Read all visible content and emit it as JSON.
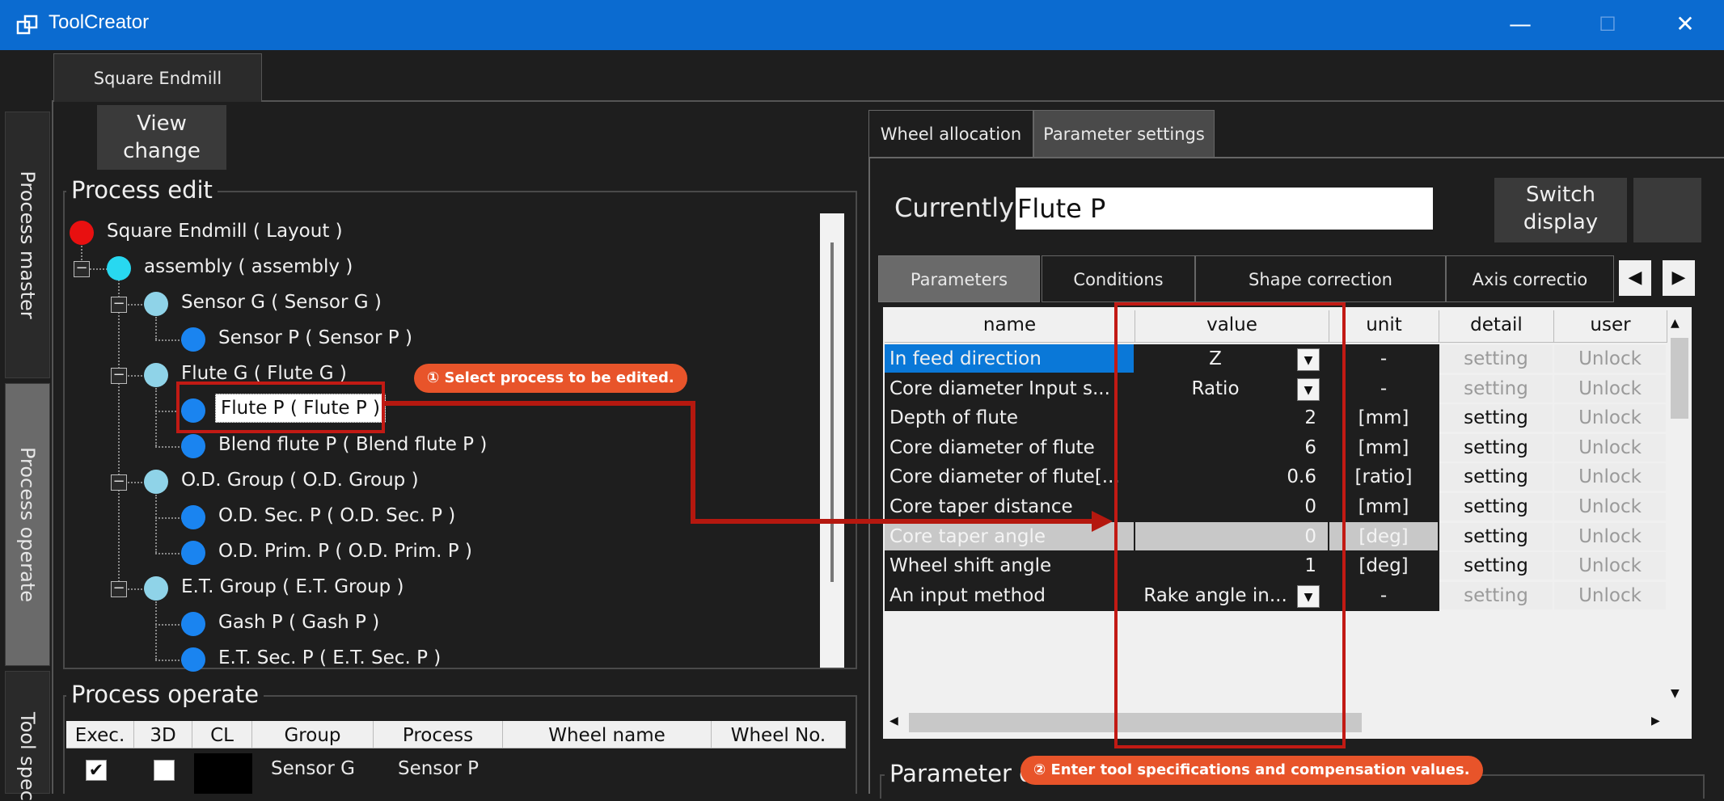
{
  "window": {
    "title": "ToolCreator",
    "minimize_glyph": "—",
    "maximize_glyph": "☐",
    "close_glyph": "✕"
  },
  "side_tabs": [
    "Process master",
    "Process operate",
    "Tool spec"
  ],
  "top_tab": "Square Endmill",
  "view_change_label": "View\nchange",
  "process_edit": {
    "title": "Process edit",
    "tree": [
      {
        "label": "Square Endmill ( Layout )",
        "color": "#e81010"
      },
      {
        "label": "assembly ( assembly )",
        "color": "#28d8f0"
      },
      {
        "label": "Sensor G ( Sensor G )",
        "color": "#8fd3e8"
      },
      {
        "label": "Sensor P ( Sensor P )",
        "color": "#1a84f0"
      },
      {
        "label": "Flute G ( Flute G )",
        "color": "#8fd3e8"
      },
      {
        "label": "Flute P ( Flute P )",
        "color": "#1a84f0"
      },
      {
        "label": "Blend flute P ( Blend flute P )",
        "color": "#1a84f0"
      },
      {
        "label": "O.D. Group ( O.D. Group )",
        "color": "#8fd3e8"
      },
      {
        "label": "O.D. Sec. P ( O.D. Sec. P )",
        "color": "#1a84f0"
      },
      {
        "label": "O.D. Prim. P ( O.D. Prim. P )",
        "color": "#1a84f0"
      },
      {
        "label": "E.T. Group  ( E.T. Group  )",
        "color": "#8fd3e8"
      },
      {
        "label": "Gash P ( Gash P )",
        "color": "#1a84f0"
      },
      {
        "label": "E.T. Sec. P ( E.T. Sec. P )",
        "color": "#1a84f0"
      }
    ]
  },
  "process_operate": {
    "title": "Process operate",
    "columns": [
      "Exec.",
      "3D",
      "CL",
      "Group",
      "Process",
      "Wheel name",
      "Wheel No."
    ],
    "row": {
      "group": "Sensor G",
      "process": "Sensor P"
    }
  },
  "right_tabs": {
    "wheel_allocation": "Wheel allocation",
    "parameter_settings": "Parameter settings"
  },
  "currently": {
    "label": "Currently",
    "value": "Flute P"
  },
  "switch_display_label": "Switch\ndisplay",
  "param_tabs": [
    "Parameters",
    "Conditions",
    "Shape correction",
    "Axis correctio"
  ],
  "grid": {
    "columns": [
      "name",
      "value",
      "unit",
      "detail",
      "user"
    ],
    "rows": [
      {
        "name": "In feed direction",
        "value": "Z",
        "unit": "-",
        "detail": "setting",
        "user": "Unlock"
      },
      {
        "name": "Core diameter Input s...",
        "value": "Ratio",
        "unit": "-",
        "detail": "setting",
        "user": "Unlock"
      },
      {
        "name": "Depth of flute",
        "value": "2",
        "unit": "[mm]",
        "detail": "setting",
        "user": "Unlock"
      },
      {
        "name": "Core diameter of flute",
        "value": "6",
        "unit": "[mm]",
        "detail": "setting",
        "user": "Unlock"
      },
      {
        "name": "Core diameter of flute[...",
        "value": "0.6",
        "unit": "[ratio]",
        "detail": "setting",
        "user": "Unlock"
      },
      {
        "name": "Core taper distance",
        "value": "0",
        "unit": "[mm]",
        "detail": "setting",
        "user": "Unlock"
      },
      {
        "name": "Core taper angle",
        "value": "0",
        "unit": "[deg]",
        "detail": "setting",
        "user": "Unlock"
      },
      {
        "name": "Wheel shift angle",
        "value": "1",
        "unit": "[deg]",
        "detail": "setting",
        "user": "Unlock"
      },
      {
        "name": "An input method",
        "value": "Rake angle in...",
        "unit": "-",
        "detail": "setting",
        "user": "Unlock"
      }
    ]
  },
  "parameter_detail_title": "Parameter d",
  "annotations": {
    "step1": "① Select process to be edited.",
    "step2": "② Enter tool specifications and compensation values."
  },
  "colors": {
    "titlebar": "#0b6bd0",
    "selection": "#0a78d8",
    "annotation": "#e8542a",
    "highlight_box": "#c21a14"
  }
}
